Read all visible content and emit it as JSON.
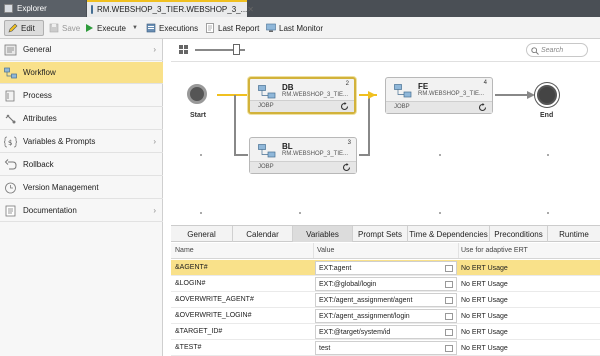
{
  "tabs": [
    {
      "label": "Explorer"
    },
    {
      "label": "RM.WEBSHOP_3_TIER.WEBSHOP_3_..."
    }
  ],
  "toolbar": {
    "edit": "Edit",
    "save": "Save",
    "execute": "Execute",
    "executions": "Executions",
    "last_report": "Last Report",
    "last_monitor": "Last Monitor"
  },
  "nav": {
    "items": [
      {
        "label": "General"
      },
      {
        "label": "Workflow"
      },
      {
        "label": "Process"
      },
      {
        "label": "Attributes"
      },
      {
        "label": "Variables & Prompts"
      },
      {
        "label": "Rollback"
      },
      {
        "label": "Version Management"
      },
      {
        "label": "Documentation"
      }
    ]
  },
  "search": {
    "placeholder": "Search"
  },
  "workflow": {
    "start_label": "Start",
    "end_label": "End",
    "tasks": [
      {
        "name": "DB",
        "number": "2",
        "object": "RM.WEBSHOP_3_TIE...",
        "type": "JOBP"
      },
      {
        "name": "BL",
        "number": "3",
        "object": "RM.WEBSHOP_3_TIE...",
        "type": "JOBP"
      },
      {
        "name": "FE",
        "number": "4",
        "object": "RM.WEBSHOP_3_TIE...",
        "type": "JOBP"
      }
    ]
  },
  "panel_tabs": [
    "General",
    "Calendar",
    "Variables",
    "Prompt Sets",
    "Time & Dependencies",
    "Preconditions",
    "Runtime"
  ],
  "variables": {
    "headers": {
      "name": "Name",
      "value": "Value",
      "use": "Use for adaptive ERT"
    },
    "rows": [
      {
        "name": "&AGENT#",
        "value": "EXT:agent",
        "use": "No ERT Usage"
      },
      {
        "name": "&LOGIN#",
        "value": "EXT:@global/login",
        "use": "No ERT Usage"
      },
      {
        "name": "&OVERWRITE_AGENT#",
        "value": "EXT:/agent_assignment/agent",
        "use": "No ERT Usage"
      },
      {
        "name": "&OVERWRITE_LOGIN#",
        "value": "EXT:/agent_assignment/login",
        "use": "No ERT Usage"
      },
      {
        "name": "&TARGET_ID#",
        "value": "EXT:@target/system/id",
        "use": "No ERT Usage"
      },
      {
        "name": "&TEST#",
        "value": "test",
        "use": "No ERT Usage"
      }
    ]
  }
}
